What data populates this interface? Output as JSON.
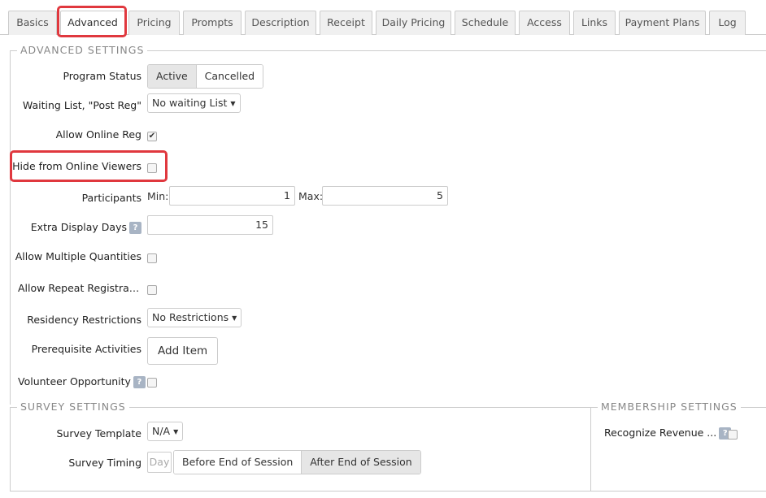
{
  "tabs": [
    {
      "label": "Basics",
      "active": false
    },
    {
      "label": "Advanced",
      "active": true
    },
    {
      "label": "Pricing",
      "active": false
    },
    {
      "label": "Prompts",
      "active": false
    },
    {
      "label": "Description",
      "active": false
    },
    {
      "label": "Receipt",
      "active": false
    },
    {
      "label": "Daily Pricing",
      "active": false
    },
    {
      "label": "Schedule",
      "active": false
    },
    {
      "label": "Access",
      "active": false
    },
    {
      "label": "Links",
      "active": false
    },
    {
      "label": "Payment Plans",
      "active": false
    },
    {
      "label": "Log",
      "active": false
    }
  ],
  "advanced": {
    "legend": "ADVANCED SETTINGS",
    "program_status": {
      "label": "Program Status",
      "options": [
        "Active",
        "Cancelled"
      ],
      "selected": "Active"
    },
    "waiting_list": {
      "label": "Waiting List, \"Post Reg\"",
      "value": "No waiting List"
    },
    "allow_online_reg": {
      "label": "Allow Online Reg",
      "checked": true,
      "check_glyph": "✔"
    },
    "hide_online": {
      "label": "Hide from Online Viewers",
      "checked": false
    },
    "participants": {
      "label": "Participants",
      "min_label": "Min:",
      "min_value": "1",
      "max_label": "Max:",
      "max_value": "5"
    },
    "extra_display_days": {
      "label": "Extra Display Days",
      "value": "15"
    },
    "allow_multiple_quantities": {
      "label": "Allow Multiple Quantities",
      "checked": false
    },
    "allow_repeat_registration": {
      "label": "Allow Repeat Registration",
      "checked": false
    },
    "residency_restrictions": {
      "label": "Residency Restrictions",
      "value": "No Restrictions"
    },
    "prerequisite_activities": {
      "label": "Prerequisite Activities",
      "button": "Add Item"
    },
    "volunteer_opportunity": {
      "label": "Volunteer Opportunity",
      "checked": false
    }
  },
  "help_glyph": "?",
  "caret_glyph": "▼",
  "survey": {
    "legend": "SURVEY SETTINGS",
    "template": {
      "label": "Survey Template",
      "value": "N/A"
    },
    "timing": {
      "label": "Survey Timing",
      "day_placeholder": "Day",
      "options": [
        "Before End of Session",
        "After End of Session"
      ],
      "selected": "After End of Session"
    }
  },
  "membership": {
    "legend": "MEMBERSHIP SETTINGS",
    "recognize_revenue": {
      "label": "Recognize Revenue ...",
      "checked": false
    }
  },
  "colors": {
    "highlight": "#e0383e",
    "help_badge": "#a8b4c4"
  }
}
